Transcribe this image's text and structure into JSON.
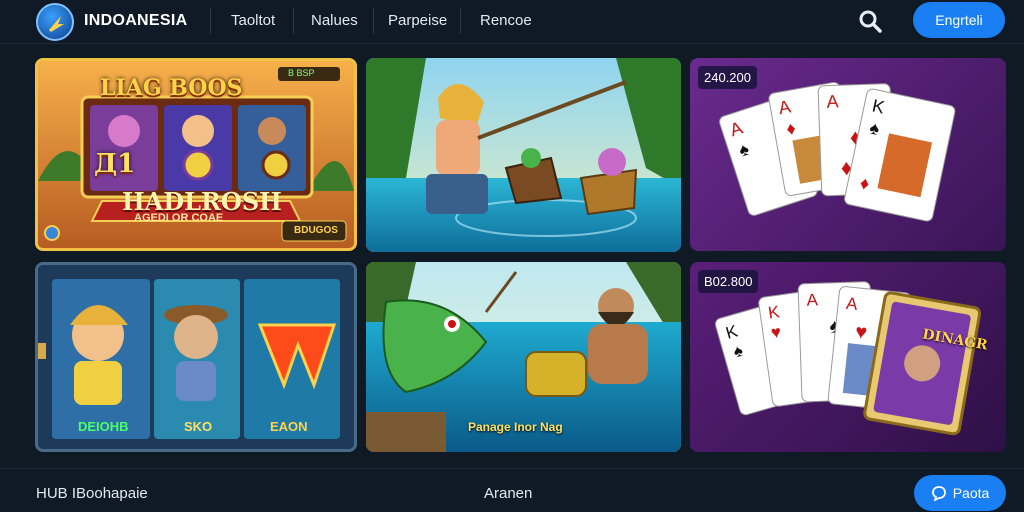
{
  "header": {
    "brand": "INDOANESIA",
    "nav": [
      "Taoltot",
      "Nalues",
      "Parpeise",
      "Rencoe"
    ],
    "language_button": "Engrteli"
  },
  "games": {
    "slot_top": {
      "title": "LIAG BOOS",
      "reel_a": "Д1",
      "banner": "HADLROSH",
      "subbanner": "AGEDI OR COAE",
      "corner_tag": "B BSP",
      "bottom_tag": "BDUGOS"
    },
    "slot_bottom": {
      "labels": [
        "DEIOHB",
        "SKO",
        "EAON"
      ]
    },
    "fishing_bottom": {
      "caption": "Panage Inor Nag"
    },
    "cards_top": {
      "amount": "240.200"
    },
    "cards_bottom": {
      "amount": "B02.800",
      "face_card": "DINAGR"
    }
  },
  "footer": {
    "left": "HUB IBoohapaie",
    "middle": "Aranen",
    "chat_button": "Paota"
  },
  "colors": {
    "accent": "#1a7ff2",
    "background": "#101a25",
    "card_panel": "#5a1f7a"
  }
}
